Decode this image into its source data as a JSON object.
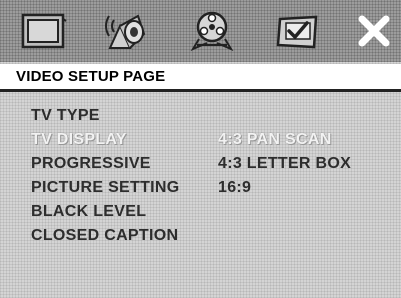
{
  "icon_bar": {
    "tabs": [
      {
        "id": "general",
        "icon": "tv-screen-icon"
      },
      {
        "id": "audio",
        "icon": "speaker-icon"
      },
      {
        "id": "video",
        "icon": "film-reel-icon"
      },
      {
        "id": "preference",
        "icon": "checkbox-icon"
      },
      {
        "id": "exit",
        "icon": "close-icon"
      }
    ]
  },
  "page": {
    "title": "VIDEO SETUP PAGE"
  },
  "menu": {
    "items": [
      {
        "label": "TV TYPE"
      },
      {
        "label": "TV DISPLAY",
        "selected": true
      },
      {
        "label": "PROGRESSIVE"
      },
      {
        "label": "PICTURE SETTING"
      },
      {
        "label": "BLACK LEVEL"
      },
      {
        "label": "CLOSED CAPTION"
      }
    ]
  },
  "options": {
    "items": [
      {
        "label": "4:3 PAN SCAN",
        "selected": true
      },
      {
        "label": "4:3 LETTER BOX"
      },
      {
        "label": "16:9"
      }
    ]
  },
  "colors": {
    "icon_bar": "#9c9c9c",
    "panel": "#d4d4d4",
    "text": "#2d2d2d",
    "highlight_text": "#f2f2f2"
  }
}
